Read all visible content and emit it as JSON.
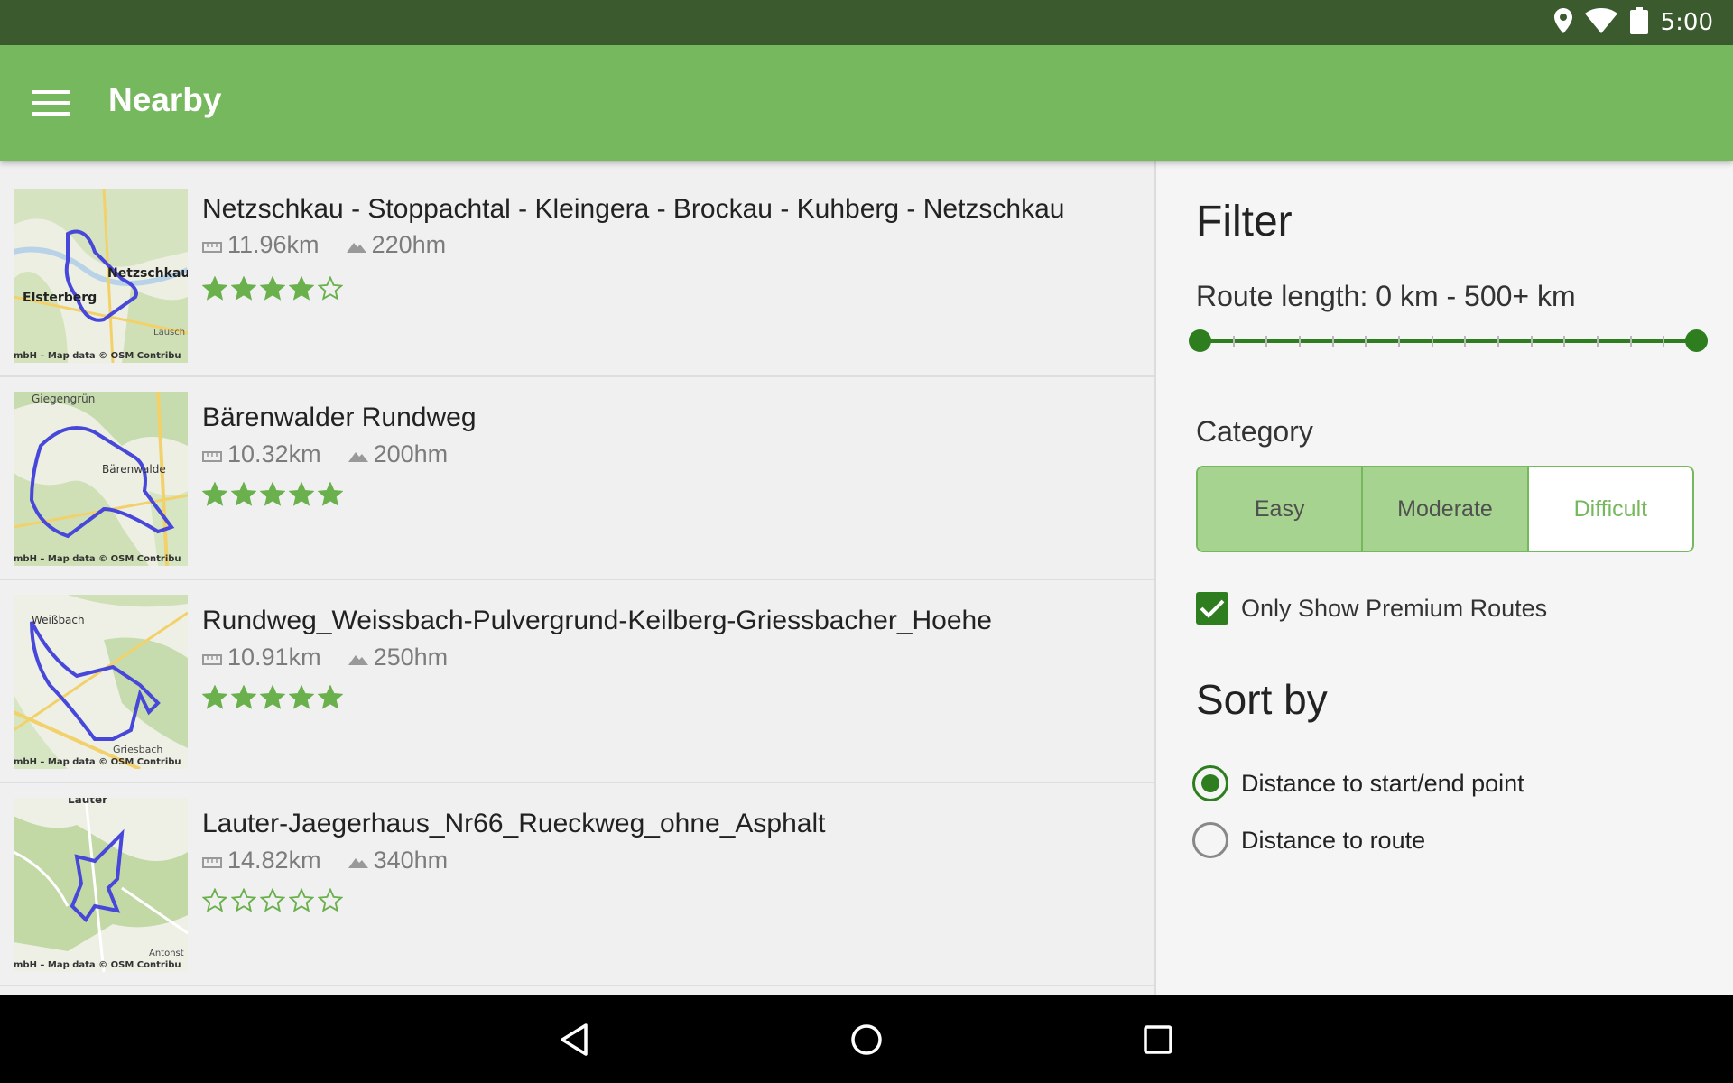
{
  "status_bar": {
    "time": "5:00",
    "icons": [
      "location-icon",
      "wifi-icon",
      "battery-icon"
    ]
  },
  "app_bar": {
    "title": "Nearby",
    "menu_icon": "hamburger-menu-icon"
  },
  "routes": [
    {
      "name": "Netzschkau - Stoppachtal - Kleingera - Brockau - Kuhberg - Netzschkau",
      "distance": "11.96km",
      "elevation": "220hm",
      "rating": 4,
      "map_labels": [
        "Netzschkau",
        "Elsterberg",
        "Lausch",
        "mbH – Map data © OSM Contribu"
      ]
    },
    {
      "name": "Bärenwalder Rundweg",
      "distance": "10.32km",
      "elevation": "200hm",
      "rating": 5,
      "map_labels": [
        "Giegengrün",
        "Bärenwalde",
        "mbH – Map data © OSM Contribu"
      ]
    },
    {
      "name": "Rundweg_Weissbach-Pulvergrund-Keilberg-Griessbacher_Hoehe",
      "distance": "10.91km",
      "elevation": "250hm",
      "rating": 5,
      "map_labels": [
        "Weißbach",
        "Griesbach",
        "mbH – Map data © OSM Contribu"
      ]
    },
    {
      "name": "Lauter-Jaegerhaus_Nr66_Rueckweg_ohne_Asphalt",
      "distance": "14.82km",
      "elevation": "340hm",
      "rating": 0,
      "map_labels": [
        "Lauter",
        "Antonst",
        "mbH – Map data © OSM Contribu"
      ]
    }
  ],
  "filter": {
    "title": "Filter",
    "route_length_label": "Route length: 0 km - 500+ km",
    "slider": {
      "min_fraction": 0.0,
      "max_fraction": 1.0
    },
    "category_label": "Category",
    "categories": [
      {
        "label": "Easy",
        "selected": true
      },
      {
        "label": "Moderate",
        "selected": true
      },
      {
        "label": "Difficult",
        "selected": false
      }
    ],
    "premium_label": "Only Show Premium Routes",
    "premium_checked": true,
    "sort_title": "Sort by",
    "sort_options": [
      {
        "label": "Distance to start/end point",
        "selected": true
      },
      {
        "label": "Distance to route",
        "selected": false
      }
    ]
  },
  "colors": {
    "status_bar": "#3b5b2f",
    "app_bar": "#76b85d",
    "accent": "#2e7d1f",
    "star": "#6ab04c",
    "route_line": "#4747d9"
  },
  "nav_bar": {
    "icons": [
      "back-icon",
      "home-icon",
      "recents-icon"
    ]
  }
}
